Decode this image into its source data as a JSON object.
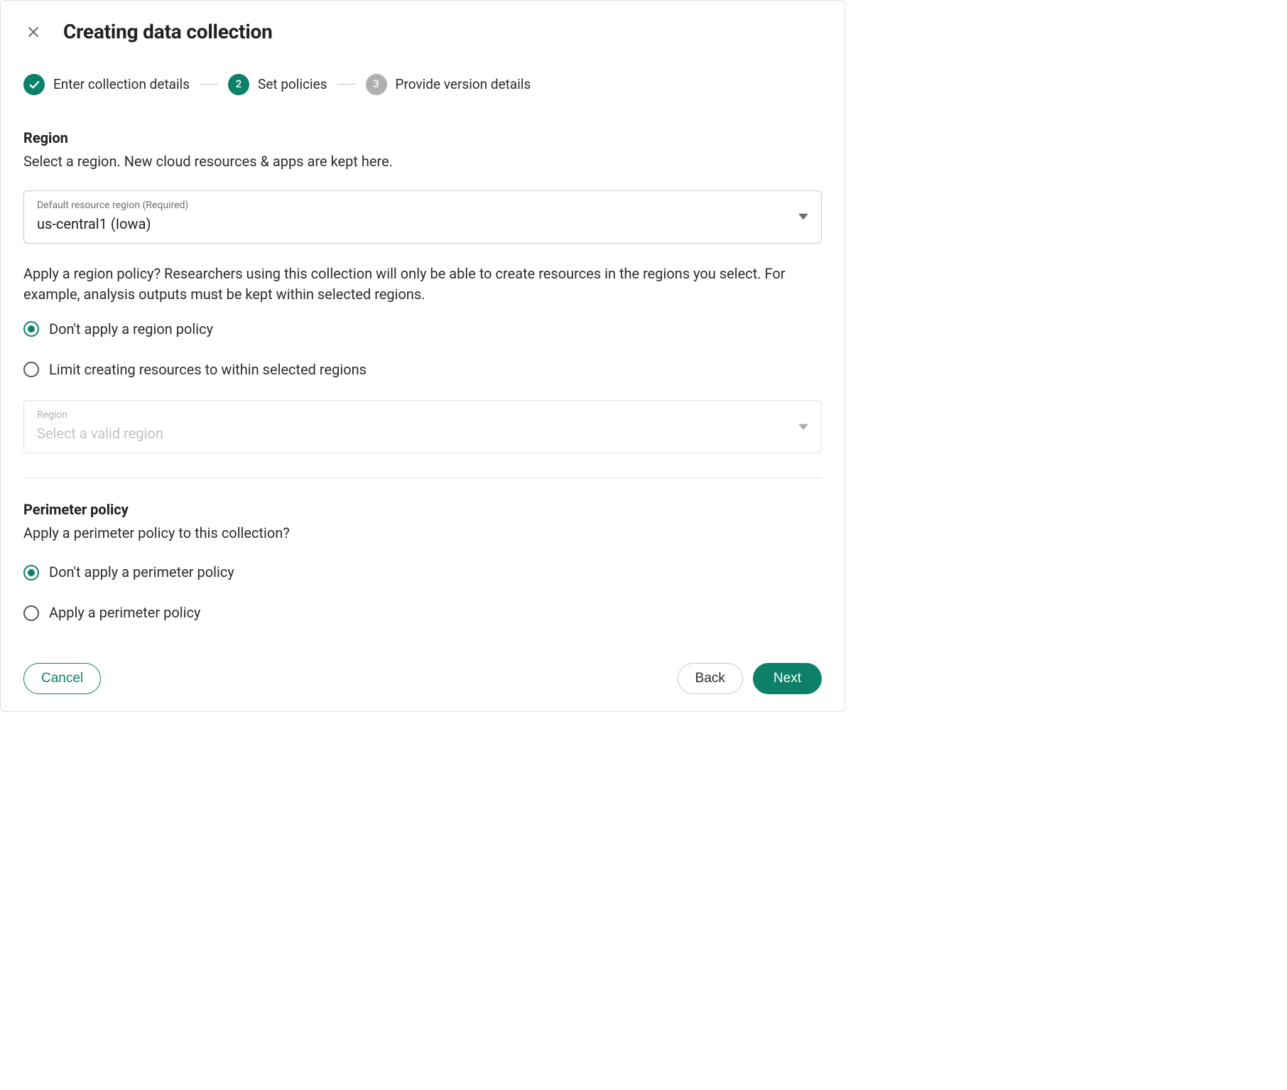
{
  "header": {
    "title": "Creating data collection"
  },
  "stepper": {
    "steps": [
      {
        "label": "Enter collection details",
        "state": "done"
      },
      {
        "label": "Set policies",
        "state": "active",
        "number": "2"
      },
      {
        "label": "Provide version details",
        "state": "pending",
        "number": "3"
      }
    ]
  },
  "region": {
    "title": "Region",
    "desc": "Select a region. New cloud resources & apps are kept here.",
    "field_label": "Default resource region (Required)",
    "field_value": "us-central1 (Iowa)",
    "policy_prompt": "Apply a region policy? Researchers using this collection will only be able to create resources in the regions you select. For example, analysis outputs must be kept within selected regions.",
    "option_none": "Don't apply a region policy",
    "option_limit": "Limit creating resources to within selected regions",
    "limit_field_label": "Region",
    "limit_field_placeholder": "Select a valid region"
  },
  "perimeter": {
    "title": "Perimeter policy",
    "prompt": "Apply a perimeter policy to this collection?",
    "option_none": "Don't apply a perimeter policy",
    "option_apply": "Apply a perimeter policy"
  },
  "footer": {
    "cancel": "Cancel",
    "back": "Back",
    "next": "Next"
  },
  "colors": {
    "accent": "#0d8069",
    "muted": "#b0b0b0"
  }
}
